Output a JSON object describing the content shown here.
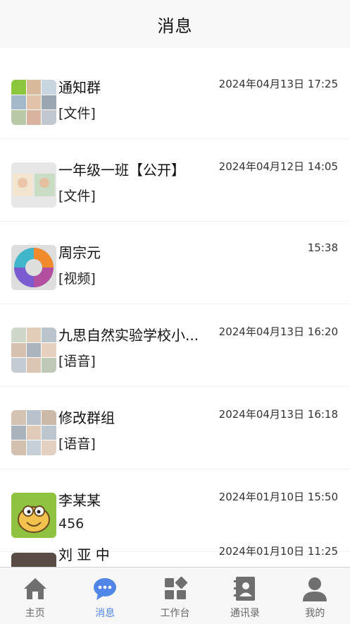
{
  "header": {
    "title": "消息"
  },
  "conversations": [
    {
      "name": "通知群",
      "preview": "[文件]",
      "time": "2024年04月13日 17:25"
    },
    {
      "name": "一年级一班【公开】",
      "preview": "[文件]",
      "time": "2024年04月12日 14:05"
    },
    {
      "name": "周宗元",
      "preview": "[视频]",
      "time": "15:38"
    },
    {
      "name": "九思自然实验学校小...",
      "preview": "[语音]",
      "time": "2024年04月13日 16:20"
    },
    {
      "name": "修改群组",
      "preview": "[语音]",
      "time": "2024年04月13日 16:18"
    },
    {
      "name": "李某某",
      "preview": "456",
      "time": "2024年01月10日 15:50"
    },
    {
      "name": "刘 亚 中",
      "preview": "",
      "time": "2024年01月10日 11:25"
    }
  ],
  "tabs": [
    {
      "label": "主页",
      "icon": "home-icon"
    },
    {
      "label": "消息",
      "icon": "chat-icon",
      "active": true
    },
    {
      "label": "工作台",
      "icon": "workbench-icon"
    },
    {
      "label": "通讯录",
      "icon": "contacts-icon"
    },
    {
      "label": "我的",
      "icon": "profile-icon"
    }
  ],
  "colors": {
    "accent": "#4f86e8",
    "tab_inactive": "#6f6f6f"
  }
}
